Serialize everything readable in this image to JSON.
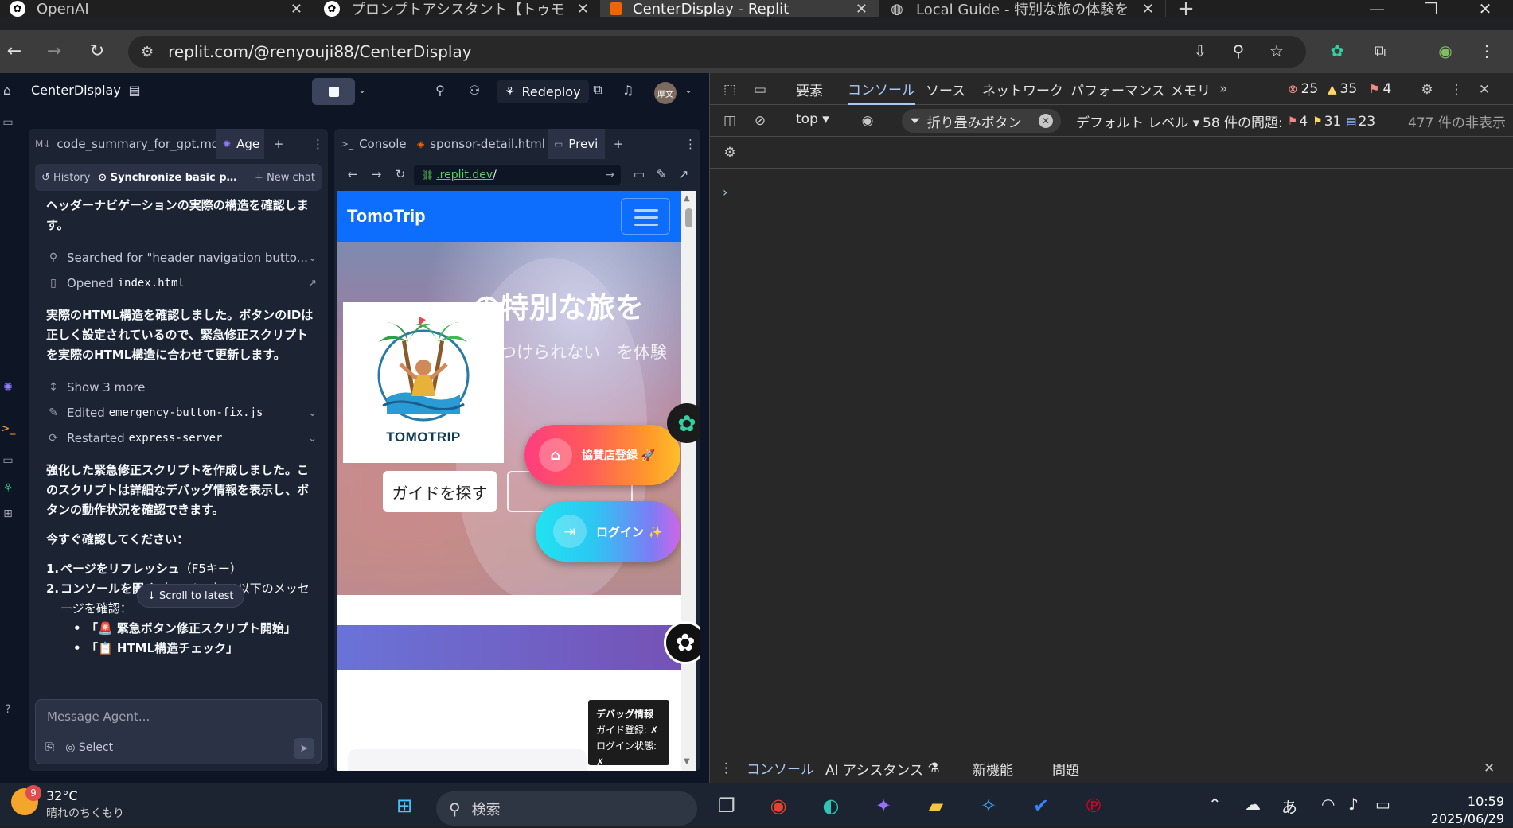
{
  "browser": {
    "tabs": [
      {
        "title": "OpenAI",
        "active": false,
        "favicon": "openai-icon"
      },
      {
        "title": "プロンプトアシスタント【トゥモローブル…",
        "active": false,
        "favicon": "openai-icon"
      },
      {
        "title": "CenterDisplay - Replit",
        "active": true,
        "favicon": "replit-icon"
      },
      {
        "title": "Local Guide - 特別な旅の体験を",
        "active": false,
        "favicon": "globe-icon"
      }
    ],
    "url": "replit.com/@renyouji88/CenterDisplay"
  },
  "replit": {
    "project_name": "CenterDisplay",
    "redeploy_label": "Redeploy",
    "avatar_text": "厚文",
    "agent_tabs": [
      {
        "label": "code_summary_for_gpt.md",
        "icon": "md-icon",
        "active": false
      },
      {
        "label": "Age",
        "icon": "agent-icon",
        "active": true
      }
    ],
    "agent_sub": {
      "history": "History",
      "chat_title": "Synchronize basic profi...",
      "new_chat": "New chat"
    },
    "feed": {
      "p1": "ヘッダーナビゲーションの実際の構造を確認します。",
      "search_action": "Searched for \"header navigation butto...",
      "opened_label": "Opened",
      "opened_file": "index.html",
      "p2": "実際のHTML構造を確認しました。ボタンのIDは正しく設定されているので、緊急修正スクリプトを実際のHTML構造に合わせて更新します。",
      "show_more": "Show 3 more",
      "edited_label": "Edited",
      "edited_file": "emergency-button-fix.js",
      "restarted_label": "Restarted",
      "restarted_target": "express-server",
      "p3": "強化した緊急修正スクリプトを作成しました。このスクリプトは詳細なデバッグ情報を表示し、ボタンの動作状況を確認できます。",
      "p4": "今すぐ確認してください：",
      "step1_bold": "ページをリフレッシュ",
      "step1_rest": "（F5キー）",
      "step2_bold": "コンソールを開く",
      "step2_rest": "（F12キー）で以下のメッセージを確認：",
      "bullet1": "「🚨 緊急ボタン修正スクリプト開始」",
      "bullet2": "「📋 HTML構造チェック」"
    },
    "scroll_latest": "Scroll to latest",
    "message_placeholder": "Message Agent...",
    "select_label": "Select",
    "preview_tabs": [
      {
        "label": "Console",
        "icon": "terminal-icon"
      },
      {
        "label": "sponsor-detail.html",
        "icon": "html-icon"
      },
      {
        "label": "Previ",
        "icon": "preview-icon"
      }
    ],
    "preview_url_domain": ".replit.dev",
    "preview_url_path": "/"
  },
  "site": {
    "brand": "TomoTrip",
    "hero_title": "の特別な旅を",
    "hero_sub": "観光では見つけられない　を体験しましょう",
    "logo_text": "TOMOTRIP",
    "find_guide": "ガイドを探す",
    "sponsor_label": "協賛店登録 🚀",
    "login_label": "ログイン ✨",
    "debug_title": "デバッグ情報",
    "debug_guide": "ガイド登録: ✗",
    "debug_login": "ログイン状態: ✗"
  },
  "devtools": {
    "tabs": [
      "要素",
      "コンソール",
      "ソース",
      "ネットワーク",
      "パフォーマンス",
      "メモリ"
    ],
    "active_tab": "コンソール",
    "errors": "25",
    "warnings": "35",
    "info": "4",
    "context": "top",
    "filter": "折り畳みボタン",
    "level": "デフォルト レベル",
    "issues_label": "58 件の問題:",
    "issues_errors": "4",
    "issues_warnings": "31",
    "issues_info": "23",
    "hidden": "477 件の非表示",
    "drawer_tabs": [
      "コンソール",
      "AI アシスタンス",
      "新機能",
      "問題"
    ]
  },
  "taskbar": {
    "badge": "9",
    "temp": "32°C",
    "weather": "晴れのちくもり",
    "search": "検索",
    "ime": "あ",
    "time": "10:59",
    "date": "2025/06/29"
  },
  "colors": {
    "replit_bg": "#0e1525",
    "pane_bg": "#1c2333",
    "devtools_bg": "#282828",
    "accent": "#a8c7fa",
    "site_nav": "#0d6efd"
  }
}
